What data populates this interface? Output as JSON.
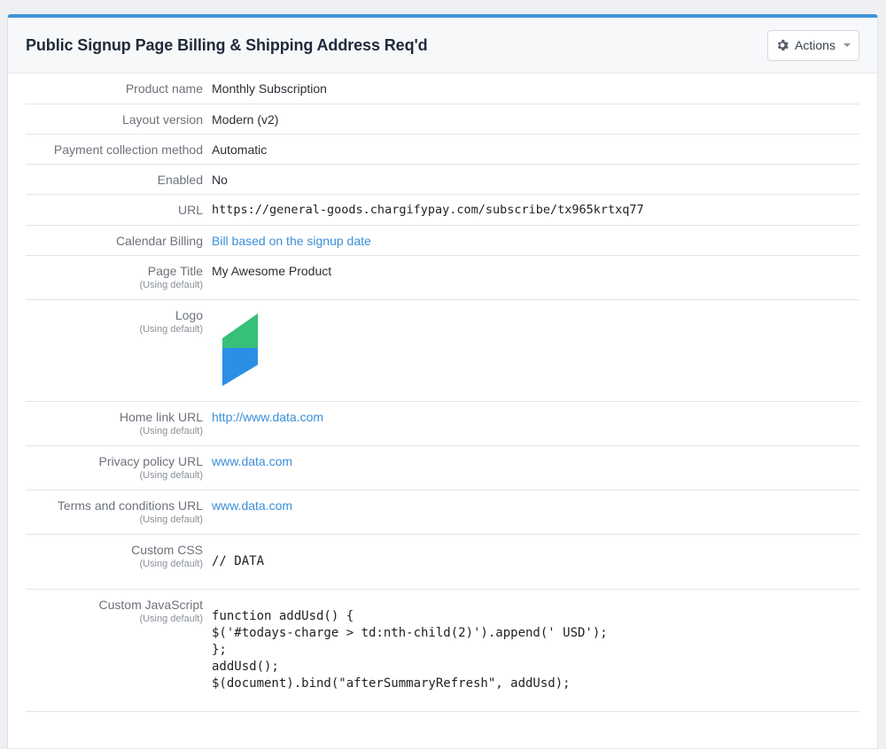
{
  "header": {
    "title": "Public Signup Page Billing & Shipping Address Req'd",
    "actions_label": "Actions"
  },
  "colors": {
    "accent": "#3f94d9",
    "link": "#3a8fd8",
    "logo_green": "#36c07a",
    "logo_blue": "#2c8fe6"
  },
  "fields": {
    "product_name": {
      "label": "Product name",
      "value": "Monthly Subscription"
    },
    "layout_version": {
      "label": "Layout version",
      "value": "Modern (v2)"
    },
    "payment_method": {
      "label": "Payment collection method",
      "value": "Automatic"
    },
    "enabled": {
      "label": "Enabled",
      "value": "No"
    },
    "url": {
      "label": "URL",
      "value": "https://general-goods.chargifypay.com/subscribe/tx965krtxq77"
    },
    "calendar_billing": {
      "label": "Calendar Billing",
      "value": "Bill based on the signup date"
    },
    "page_title": {
      "label": "Page Title",
      "note": "(Using default)",
      "value": "My Awesome Product"
    },
    "logo": {
      "label": "Logo",
      "note": "(Using default)",
      "icon": "chargify-logo-icon"
    },
    "home_link": {
      "label": "Home link URL",
      "note": "(Using default)",
      "value": "http://www.data.com"
    },
    "privacy_policy": {
      "label": "Privacy policy URL",
      "note": "(Using default)",
      "value": "www.data.com"
    },
    "terms": {
      "label": "Terms and conditions URL",
      "note": "(Using default)",
      "value": "www.data.com"
    },
    "custom_css": {
      "label": "Custom CSS",
      "note": "(Using default)",
      "value": "// DATA"
    },
    "custom_js": {
      "label": "Custom JavaScript",
      "note": "(Using default)",
      "value": "function addUsd() {\n$('#todays-charge > td:nth-child(2)').append(' USD');\n};\naddUsd();\n$(document).bind(\"afterSummaryRefresh\", addUsd);"
    }
  }
}
